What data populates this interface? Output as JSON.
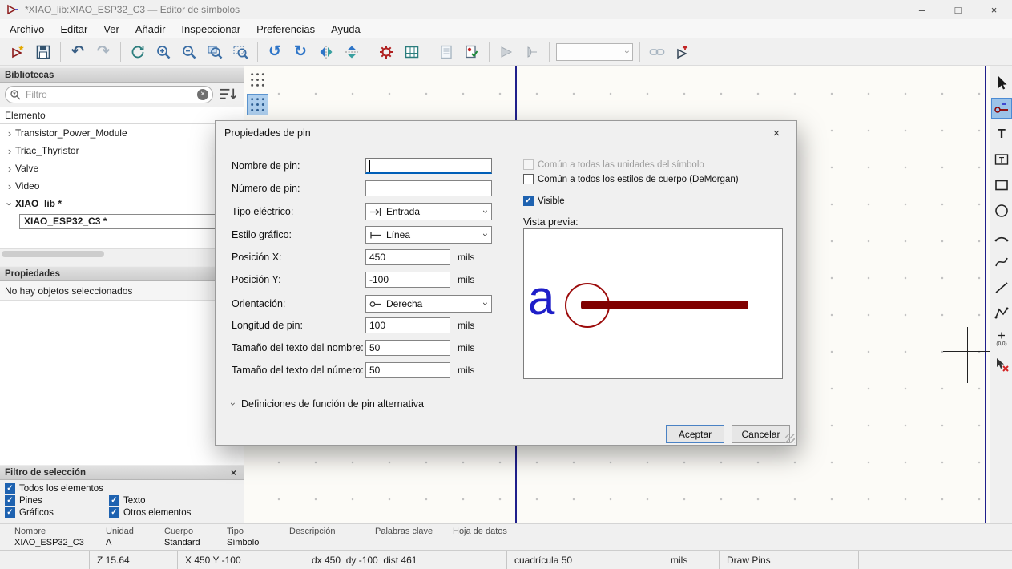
{
  "icons": {
    "check": "✓",
    "close": "×",
    "minimize": "–",
    "maximize": "□",
    "expander": "›",
    "combo_arrow": "›",
    "undo": "↶",
    "redo": "↷",
    "rotate_ccw": "↺",
    "rotate_cw": "↻"
  },
  "window": {
    "title": "*XIAO_lib:XIAO_ESP32_C3 — Editor de símbolos"
  },
  "menu": {
    "items": [
      "Archivo",
      "Editar",
      "Ver",
      "Añadir",
      "Inspeccionar",
      "Preferencias",
      "Ayuda"
    ]
  },
  "toolbar": {
    "buttons": [
      "new-symbol",
      "save",
      "undo",
      "redo",
      "refresh-view",
      "zoom-in",
      "zoom-out",
      "zoom-fit",
      "zoom-selection",
      "rotate-ccw",
      "rotate-cw",
      "mirror-horizontal",
      "mirror-vertical",
      "symbol-properties",
      "pin-table",
      "datasheet",
      "check-symbol",
      "demorgan-standard",
      "demorgan-alternate",
      "unit-selector",
      "sync-pins-edit",
      "add-symbol-to-schematic"
    ],
    "unit_selector_value": ""
  },
  "right_toolbar": {
    "buttons": [
      "select",
      "pin",
      "text",
      "textbox",
      "rectangle",
      "circle",
      "arc",
      "bezier",
      "line",
      "polygon",
      "anchor",
      "delete"
    ],
    "active_tool": "pin",
    "anchor_label": "(0,0)"
  },
  "libraries": {
    "title": "Bibliotecas",
    "filter_placeholder": "Filtro",
    "tree_header": "Elemento",
    "items": [
      {
        "label": "Transistor_Power_Module"
      },
      {
        "label": "Triac_Thyristor"
      },
      {
        "label": "Valve"
      },
      {
        "label": "Video"
      },
      {
        "label": "XIAO_lib *"
      },
      {
        "label": "XIAO_ESP32_C3 *"
      }
    ]
  },
  "properties_panel": {
    "title": "Propiedades",
    "empty_message": "No hay objetos seleccionados"
  },
  "selection_filter": {
    "title": "Filtro de selección",
    "items": [
      {
        "label": "Todos los elementos",
        "checked": true
      },
      {
        "label": "Pines",
        "checked": true
      },
      {
        "label": "Texto",
        "checked": true
      },
      {
        "label": "Gráficos",
        "checked": true
      },
      {
        "label": "Otros elementos",
        "checked": true
      }
    ]
  },
  "dialog": {
    "title": "Propiedades de pin",
    "fields": {
      "name": {
        "label": "Nombre de pin:",
        "value": ""
      },
      "number": {
        "label": "Número de pin:",
        "value": ""
      },
      "electrical_type": {
        "label": "Tipo eléctrico:",
        "value": "Entrada"
      },
      "graphic_style": {
        "label": "Estilo gráfico:",
        "value": "Línea"
      },
      "pos_x": {
        "label": "Posición X:",
        "value": "450",
        "unit": "mils"
      },
      "pos_y": {
        "label": "Posición Y:",
        "value": "-100",
        "unit": "mils"
      },
      "orientation": {
        "label": "Orientación:",
        "value": "Derecha"
      },
      "length": {
        "label": "Longitud de pin:",
        "value": "100",
        "unit": "mils"
      },
      "name_text_size": {
        "label": "Tamaño del texto del nombre:",
        "value": "50",
        "unit": "mils"
      },
      "number_text_size": {
        "label": "Tamaño del texto del número:",
        "value": "50",
        "unit": "mils"
      }
    },
    "checkboxes": {
      "common_units": {
        "label": "Común a todas las unidades del símbolo",
        "checked": false,
        "enabled": false
      },
      "common_body_styles": {
        "label": "Común a todos los estilos de cuerpo (DeMorgan)",
        "checked": false,
        "enabled": true
      },
      "visible": {
        "label": "Visible",
        "checked": true,
        "enabled": true
      }
    },
    "preview": {
      "label": "Vista previa:",
      "glyph": "a"
    },
    "alternate_section_label": "Definiciones de función de pin alternativa",
    "buttons": {
      "ok": "Aceptar",
      "cancel": "Cancelar"
    }
  },
  "infobar": {
    "columns": [
      {
        "label": "Nombre",
        "value": "XIAO_ESP32_C3"
      },
      {
        "label": "Unidad",
        "value": "A"
      },
      {
        "label": "Cuerpo",
        "value": "Standard"
      },
      {
        "label": "Tipo",
        "value": "Símbolo"
      },
      {
        "label": "Descripción",
        "value": ""
      },
      {
        "label": "Palabras clave",
        "value": ""
      },
      {
        "label": "Hoja de datos",
        "value": ""
      }
    ]
  },
  "statusbar": {
    "zoom": "Z 15.64",
    "position": "X 450 Y -100",
    "delta": "dx 450  dy -100  dist 461",
    "grid": "cuadrícula 50",
    "units": "mils",
    "mode": "Draw Pins"
  }
}
